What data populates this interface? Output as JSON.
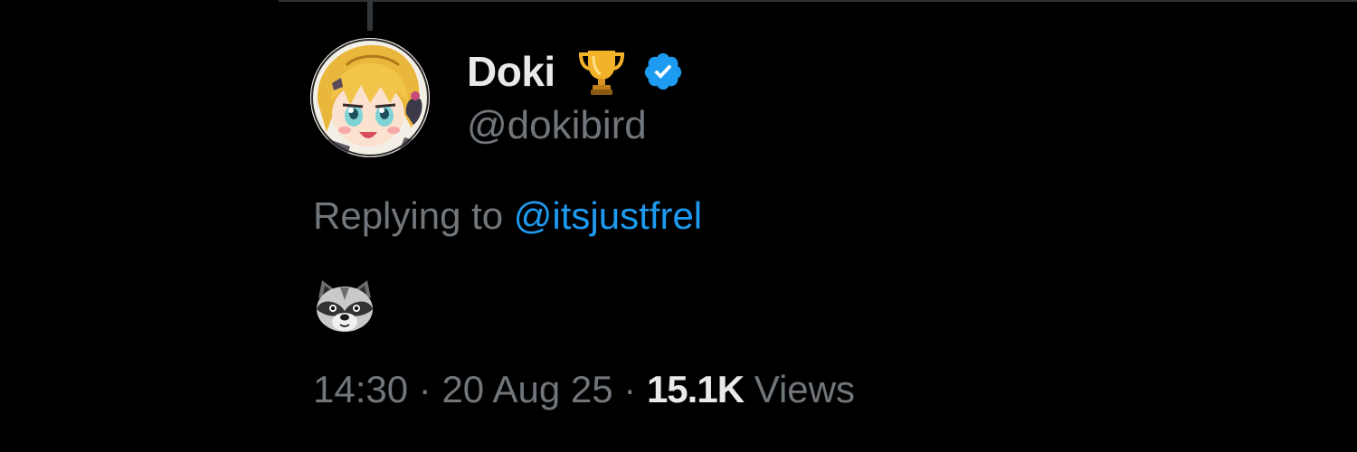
{
  "tweet": {
    "author": {
      "display_name": "Doki",
      "handle": "@dokibird",
      "badges": [
        "trophy-icon",
        "verified-icon"
      ]
    },
    "reply": {
      "prefix": "Replying to ",
      "mention": "@itsjustfrel"
    },
    "body": {
      "emoji": "raccoon-icon"
    },
    "meta": {
      "time": "14:30",
      "separator": " · ",
      "date": "20 Aug 25",
      "views_count": "15.1K",
      "views_label": " Views"
    }
  },
  "colors": {
    "background": "#000000",
    "primary_text": "#e7e9ea",
    "secondary_text": "#71767b",
    "link": "#1d9bf0",
    "verified": "#1d9bf0"
  }
}
